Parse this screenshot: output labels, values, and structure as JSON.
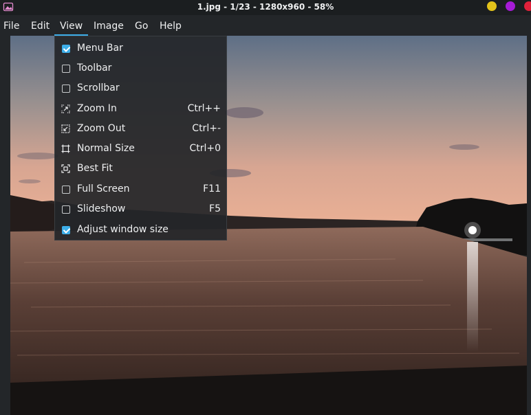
{
  "window": {
    "title": "1.jpg - 1/23 - 1280x960 - 58%",
    "buttons": [
      {
        "name": "minimize",
        "color": "#e3c31a"
      },
      {
        "name": "maximize",
        "color": "#a61bd6"
      },
      {
        "name": "close",
        "color": "#e0213a"
      }
    ]
  },
  "menubar": {
    "items": [
      "File",
      "Edit",
      "View",
      "Image",
      "Go",
      "Help"
    ],
    "active": "View"
  },
  "view_menu": {
    "items": [
      {
        "label": "Menu Bar",
        "shortcut": "",
        "kind": "check",
        "checked": true
      },
      {
        "label": "Toolbar",
        "shortcut": "",
        "kind": "check",
        "checked": false
      },
      {
        "label": "Scrollbar",
        "shortcut": "",
        "kind": "check",
        "checked": false
      },
      {
        "label": "Zoom In",
        "shortcut": "Ctrl++",
        "kind": "icon",
        "icon": "zoom-in-icon"
      },
      {
        "label": "Zoom Out",
        "shortcut": "Ctrl+-",
        "kind": "icon",
        "icon": "zoom-out-icon"
      },
      {
        "label": "Normal Size",
        "shortcut": "Ctrl+0",
        "kind": "icon",
        "icon": "normal-size-icon"
      },
      {
        "label": "Best Fit",
        "shortcut": "",
        "kind": "icon",
        "icon": "best-fit-icon"
      },
      {
        "label": "Full Screen",
        "shortcut": "F11",
        "kind": "check",
        "checked": false
      },
      {
        "label": "Slideshow",
        "shortcut": "F5",
        "kind": "check",
        "checked": false
      },
      {
        "label": "Adjust window size",
        "shortcut": "",
        "kind": "check",
        "checked": true
      }
    ]
  },
  "colors": {
    "accent": "#3daee9",
    "background": "#232629"
  }
}
